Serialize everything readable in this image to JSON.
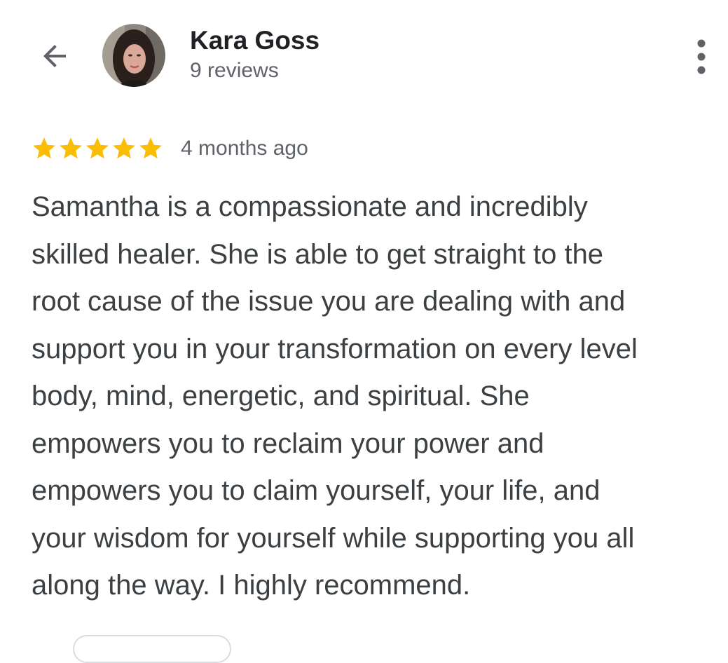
{
  "header": {
    "back_icon": "arrow-left-icon",
    "author_name": "Kara Goss",
    "review_count": "9 reviews",
    "more_icon": "more-vertical-icon"
  },
  "review": {
    "rating": 5,
    "rating_max": 5,
    "star_color": "#fbbc04",
    "date": "4 months ago",
    "text_lines": [
      "Samantha is a compassionate and incredibly",
      "skilled healer. She is able to get straight to the",
      "root cause of the issue you are dealing with and",
      "support you in your transformation on every level",
      "body, mind, energetic, and spiritual. She",
      "empowers you to reclaim your power and",
      "empowers you to claim yourself, your life, and",
      "your wisdom for yourself while supporting you all",
      "along the way. I highly recommend."
    ]
  },
  "colors": {
    "primary_text": "#202124",
    "secondary_text": "#5f6368",
    "body_text": "#3c4043"
  }
}
